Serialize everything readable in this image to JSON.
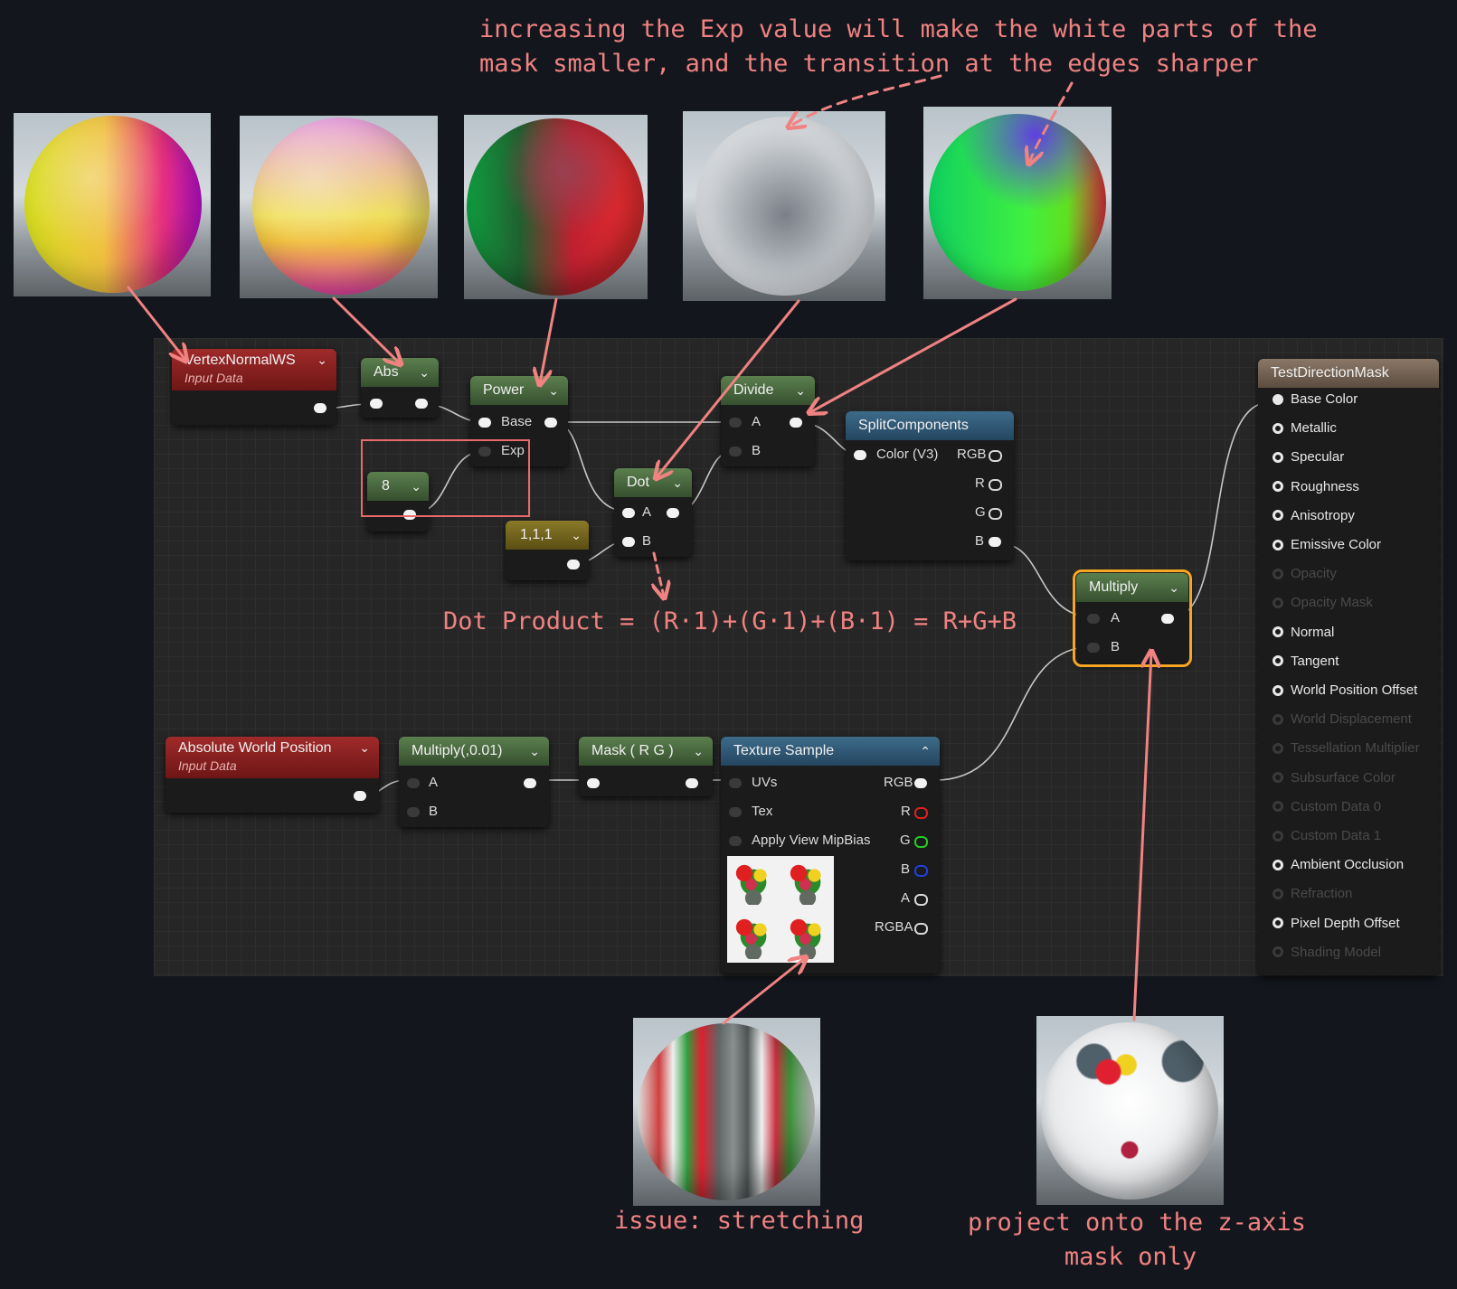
{
  "annotations": {
    "exp_note_line1": "increasing the Exp value will make the white parts of the",
    "exp_note_line2": "mask smaller, and the transition at the edges sharper",
    "dot_note": "Dot Product = (R·1)+(G·1)+(B·1) = R+G+B",
    "stretch_note": "issue: stretching",
    "project_note_line1": "project onto the z-axis",
    "project_note_line2": "mask only"
  },
  "nodes": {
    "vertex_normal": {
      "title": "VertexNormalWS",
      "subtitle": "Input Data"
    },
    "abs": {
      "title": "Abs"
    },
    "power": {
      "title": "Power",
      "pin_base": "Base",
      "pin_exp": "Exp"
    },
    "constant_exp": {
      "value": "8"
    },
    "constant_vec": {
      "value": "1,1,1"
    },
    "dot": {
      "title": "Dot",
      "pin_a": "A",
      "pin_b": "B"
    },
    "divide": {
      "title": "Divide",
      "pin_a": "A",
      "pin_b": "B"
    },
    "split": {
      "title": "SplitComponents",
      "pin_in": "Color (V3)",
      "out_rgb": "RGB",
      "out_r": "R",
      "out_g": "G",
      "out_b": "B"
    },
    "multiply_main": {
      "title": "Multiply",
      "pin_a": "A",
      "pin_b": "B"
    },
    "abs_world_pos": {
      "title": "Absolute World Position",
      "subtitle": "Input Data"
    },
    "multiply_scale": {
      "title": "Multiply(,0.01)",
      "pin_a": "A",
      "pin_b": "B"
    },
    "mask_rg": {
      "title": "Mask ( R G )"
    },
    "texture_sample": {
      "title": "Texture Sample",
      "pin_uvs": "UVs",
      "pin_tex": "Tex",
      "pin_mip": "Apply View MipBias",
      "out_rgb": "RGB",
      "out_r": "R",
      "out_g": "G",
      "out_b": "B",
      "out_a": "A",
      "out_rgba": "RGBA"
    }
  },
  "material_output": {
    "title": "TestDirectionMask",
    "pins": [
      {
        "label": "Base Color",
        "active": true,
        "connected": true
      },
      {
        "label": "Metallic",
        "active": true
      },
      {
        "label": "Specular",
        "active": true
      },
      {
        "label": "Roughness",
        "active": true
      },
      {
        "label": "Anisotropy",
        "active": true
      },
      {
        "label": "Emissive Color",
        "active": true
      },
      {
        "label": "Opacity",
        "active": false
      },
      {
        "label": "Opacity Mask",
        "active": false
      },
      {
        "label": "Normal",
        "active": true
      },
      {
        "label": "Tangent",
        "active": true
      },
      {
        "label": "World Position Offset",
        "active": true
      },
      {
        "label": "World Displacement",
        "active": false
      },
      {
        "label": "Tessellation Multiplier",
        "active": false
      },
      {
        "label": "Subsurface Color",
        "active": false
      },
      {
        "label": "Custom Data 0",
        "active": false
      },
      {
        "label": "Custom Data 1",
        "active": false
      },
      {
        "label": "Ambient Occlusion",
        "active": true
      },
      {
        "label": "Refraction",
        "active": false
      },
      {
        "label": "Pixel Depth Offset",
        "active": true
      },
      {
        "label": "Shading Model",
        "active": false
      }
    ]
  },
  "colors": {
    "annotation": "#f08282",
    "highlight_box": "#e86a6a",
    "selected_outline": "#f5a623",
    "pin_r": "#e02020",
    "pin_g": "#20d020",
    "pin_b": "#2040e0"
  }
}
